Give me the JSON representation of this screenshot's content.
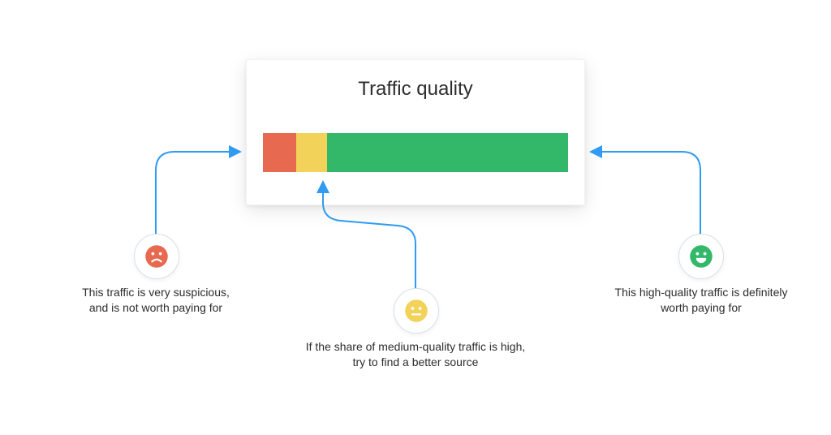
{
  "title": "Traffic quality",
  "segments": {
    "red": {
      "color": "#e7694f",
      "widthPct": 11
    },
    "yellow": {
      "color": "#f3d259",
      "widthPct": 10
    },
    "green": {
      "color": "#33b86a",
      "widthPct": 79
    }
  },
  "captions": {
    "red": "This traffic is very suspicious,\nand is not worth paying for",
    "yellow": "If the share of medium-quality traffic is high,\ntry to find a better source",
    "green": "This high-quality traffic is definitely\nworth paying for"
  },
  "icons": {
    "red": "sad-face-icon",
    "yellow": "neutral-face-icon",
    "green": "happy-face-icon"
  },
  "colors": {
    "arrow": "#2f9bf2",
    "badgeBorder": "#d8e0e6"
  }
}
